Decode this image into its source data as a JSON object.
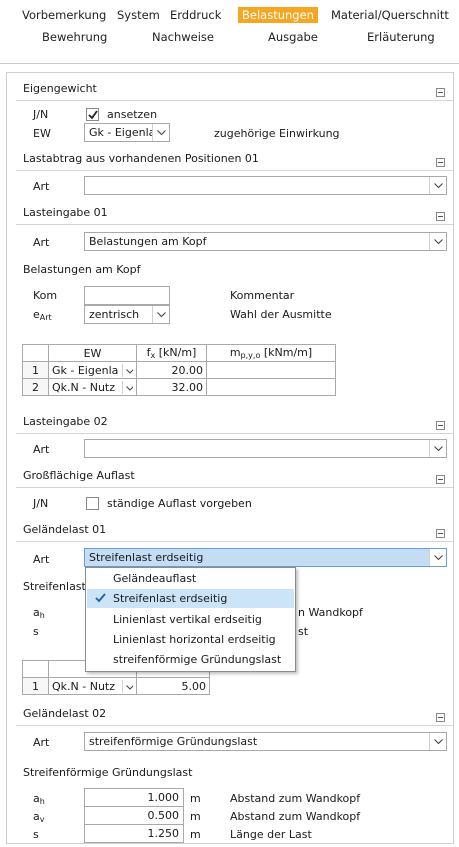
{
  "tabs": {
    "row1": [
      "Vorbemerkung",
      "System",
      "Erddruck",
      "Belastungen",
      "Material/Querschnitt"
    ],
    "row2": [
      "Bewehrung",
      "Nachweise",
      "Ausgabe",
      "Erläuterung"
    ],
    "active": "Belastungen",
    "active_color": "#f5a623"
  },
  "eigengewicht": {
    "title": "Eigengewicht",
    "jn_label": "J/N",
    "ansetzen_label": "ansetzen",
    "ansetzen_checked": true,
    "ew_label": "EW",
    "ew_value": "Gk - Eigenla",
    "ew_comment": "zugehörige Einwirkung"
  },
  "lastabtrag": {
    "title": "Lastabtrag aus vorhandenen Positionen 01",
    "art_label": "Art",
    "art_value": ""
  },
  "lasteingabe01": {
    "title": "Lasteingabe 01",
    "art_label": "Art",
    "art_value": "Belastungen am Kopf",
    "sub_title": "Belastungen am Kopf",
    "kom_label": "Kom",
    "kom_value": "",
    "kom_comment": "Kommentar",
    "eart_label": "e",
    "eart_sub": "Art",
    "eart_value": "zentrisch",
    "eart_comment": "Wahl der Ausmitte",
    "table": {
      "col_ew": "EW",
      "col_fx": "f",
      "col_fx_sub": "x",
      "col_fx_unit": " [kN/m]",
      "col_m": "m",
      "col_m_sub": "p,y,o",
      "col_m_unit": " [kNm/m]",
      "rows": [
        {
          "idx": "1",
          "ew": "Gk - Eigenla",
          "fx": "20.00",
          "m": ""
        },
        {
          "idx": "2",
          "ew": "Qk.N - Nutz",
          "fx": "32.00",
          "m": ""
        }
      ]
    }
  },
  "lasteingabe02": {
    "title": "Lasteingabe 02",
    "art_label": "Art",
    "art_value": ""
  },
  "grossflaechig": {
    "title": "Großflächige Auflast",
    "jn_label": "J/N",
    "check_label": "ständige Auflast vorgeben",
    "checked": false
  },
  "gelaendelast01": {
    "title": "Geländelast 01",
    "art_label": "Art",
    "art_value": "Streifenlast erdseitig",
    "sub_title": "Streifenlast",
    "ah_label": "a",
    "ah_sub": "h",
    "s_label": "s",
    "partial_comment1": "n Wandkopf",
    "partial_comment2": "st",
    "table_row": {
      "idx": "1",
      "ew": "Qk.N - Nutz",
      "value": "5.00"
    }
  },
  "dropdown": {
    "options": [
      "Geländeauflast",
      "Streifenlast erdseitig",
      "Linienlast vertikal erdseitig",
      "Linienlast horizontal erdseitig",
      "streifenförmige Gründungslast"
    ],
    "selected": "Streifenlast erdseitig"
  },
  "gelaendelast02": {
    "title": "Geländelast 02",
    "art_label": "Art",
    "art_value": "streifenförmige Gründungslast",
    "sub_title": "Streifenförmige Gründungslast",
    "params": [
      {
        "label": "a",
        "sub": "h",
        "value": "1.000",
        "unit": "m",
        "comment": "Abstand zum Wandkopf"
      },
      {
        "label": "a",
        "sub": "v",
        "value": "0.500",
        "unit": "m",
        "comment": "Abstand zum Wandkopf"
      },
      {
        "label": "s",
        "sub": "",
        "value": "1.250",
        "unit": "m",
        "comment": "Länge der Last"
      }
    ]
  }
}
